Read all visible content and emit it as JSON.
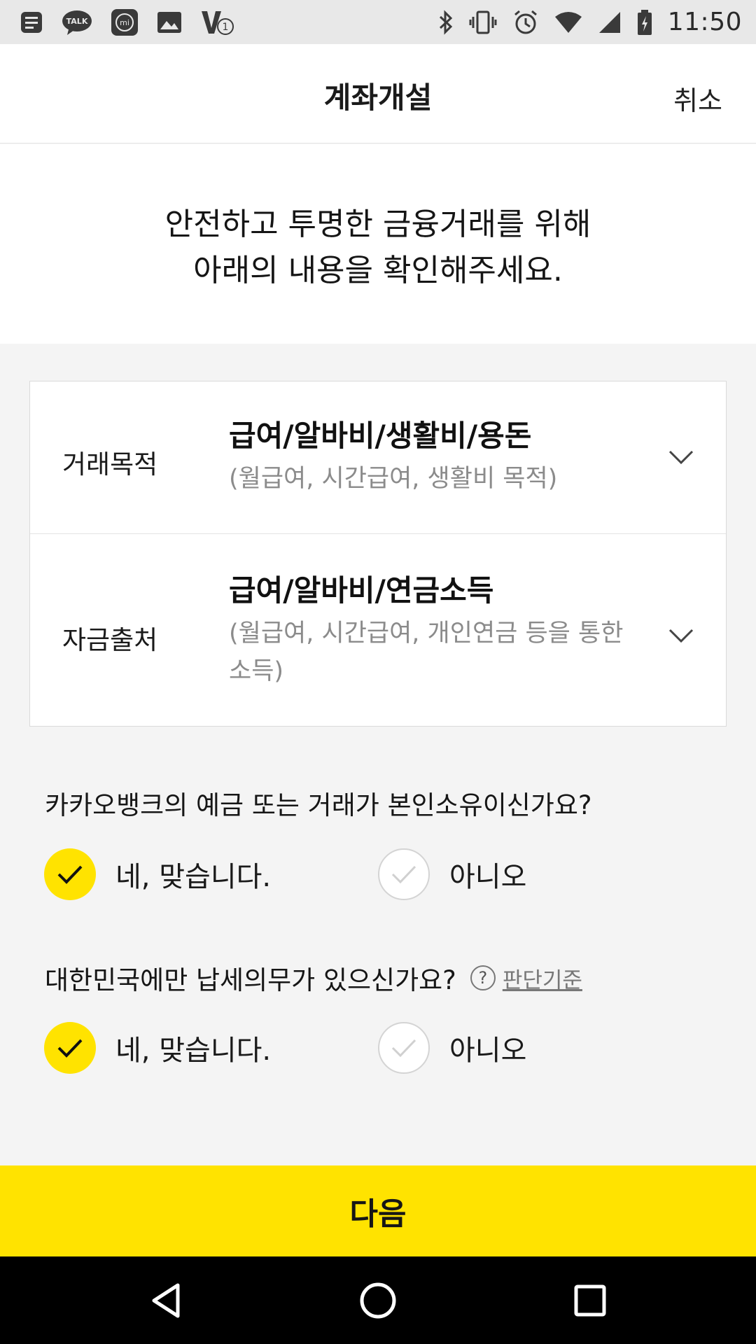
{
  "status_bar": {
    "time": "11:50",
    "left_icons": [
      "notes-icon",
      "kakaotalk-icon",
      "mi-icon",
      "gallery-icon",
      "app-update-icon"
    ],
    "right_icons": [
      "bluetooth-icon",
      "vibrate-icon",
      "alarm-icon",
      "wifi-icon",
      "signal-icon",
      "battery-icon"
    ]
  },
  "header": {
    "title": "계좌개설",
    "cancel_label": "취소"
  },
  "intro": {
    "line1": "안전하고 투명한 금융거래를 위해",
    "line2": "아래의 내용을 확인해주세요."
  },
  "form": {
    "rows": [
      {
        "label": "거래목적",
        "value": "급여/알바비/생활비/용돈",
        "description_lines": [
          "(월급여, 시간급여, 생활비 목적)"
        ]
      },
      {
        "label": "자금출처",
        "value": "급여/알바비/연금소득",
        "description_lines": [
          "(월급여, 시간급여, 개인연금 등을 통한",
          "소득)"
        ]
      }
    ]
  },
  "questions": [
    {
      "text": "카카오뱅크의 예금 또는 거래가 본인소유이신가요?",
      "options": [
        {
          "label": "네, 맞습니다.",
          "selected": true
        },
        {
          "label": "아니오",
          "selected": false
        }
      ]
    },
    {
      "text": "대한민국에만 납세의무가 있으신가요?",
      "help_label": "판단기준",
      "options": [
        {
          "label": "네, 맞습니다.",
          "selected": true
        },
        {
          "label": "아니오",
          "selected": false
        }
      ]
    }
  ],
  "next_button_label": "다음",
  "colors": {
    "accent_yellow": "#ffe300",
    "background": "#f4f4f4",
    "muted_text": "#8b8b8b"
  }
}
